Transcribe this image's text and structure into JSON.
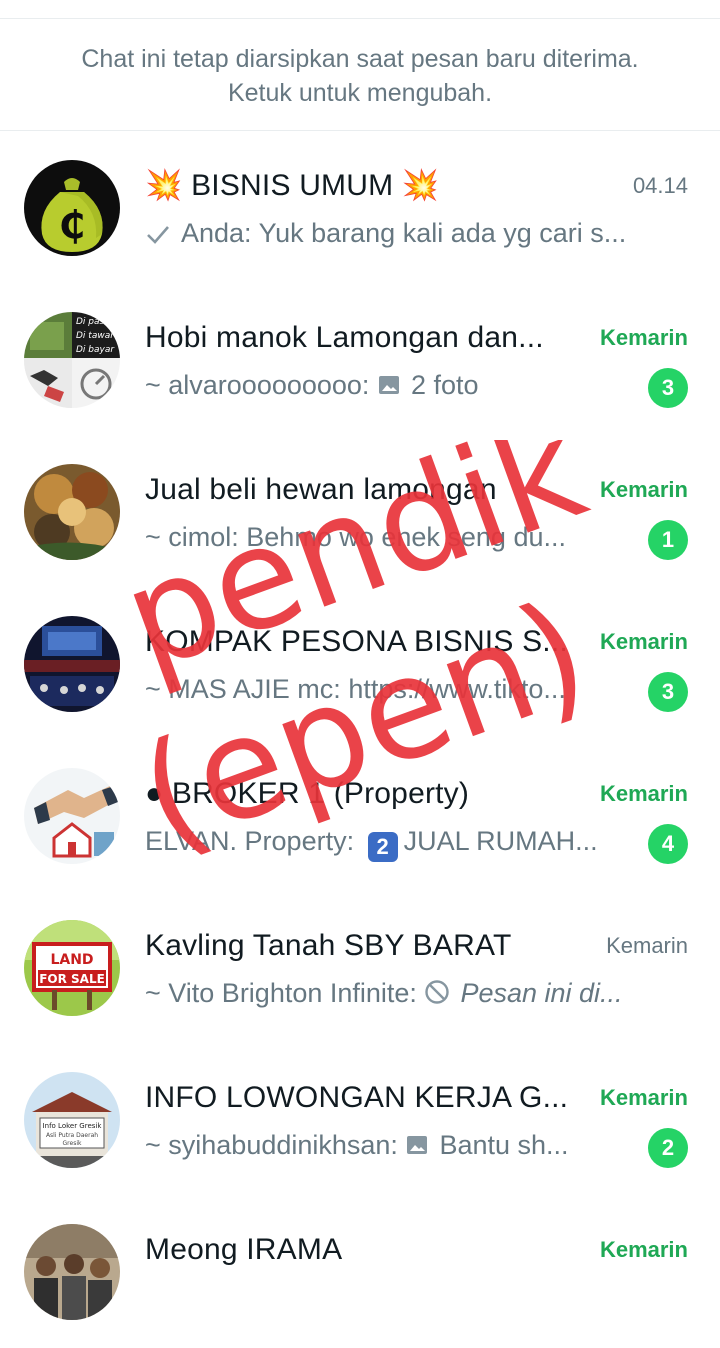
{
  "archive_note": {
    "line1": "Chat ini tetap diarsipkan saat pesan baru diterima.",
    "line2": "Ketuk untuk mengubah."
  },
  "chats": [
    {
      "name": "💥 BISNIS UMUM 💥",
      "time": "04.14",
      "unread": false,
      "sender": "Anda: ",
      "text": "Yuk barang kali ada yg cari s...",
      "icon": "check-icon"
    },
    {
      "name": "Hobi manok Lamongan dan...",
      "time": "Kemarin",
      "unread": true,
      "badge": "3",
      "sender": "~ alvarooooooooo: ",
      "text": "2 foto",
      "icon": "photo-icon"
    },
    {
      "name": "Jual beli hewan lamongan",
      "time": "Kemarin",
      "unread": true,
      "badge": "1",
      "sender": "~ cimol: ",
      "text": "Behmo wo enek seng du..."
    },
    {
      "name": "KOMPAK PESONA BISNIS S...",
      "time": "Kemarin",
      "unread": true,
      "badge": "3",
      "sender": "~ MAS AJIE mc: ",
      "text": "https://www.tikto..."
    },
    {
      "name": "● BROKER 1 (Property)",
      "time": "Kemarin",
      "unread": true,
      "badge": "4",
      "sender": "ELVAN. Property: ",
      "keycap": "2",
      "text": "JUAL RUMAH..."
    },
    {
      "name": "Kavling Tanah SBY BARAT",
      "time": "Kemarin",
      "unread": false,
      "sender": "~ Vito Brighton Infinite: ",
      "text": "Pesan ini di...",
      "icon": "deleted-icon"
    },
    {
      "name": "INFO LOWONGAN KERJA G...",
      "time": "Kemarin",
      "unread": true,
      "badge": "2",
      "sender": "~ syihabuddinikhsan: ",
      "text": "Bantu sh...",
      "icon": "photo-icon"
    },
    {
      "name": "Meong IRAMA",
      "time": "Kemarin",
      "unread": true
    }
  ],
  "avatar_text": {
    "hobi_lines": [
      "Di pasar",
      "Di tawar",
      "Di bayar"
    ],
    "land_line1": "LAND",
    "land_line2": "FOR SALE",
    "info_loker_line1": "Info Loker Gresik",
    "info_loker_line2": "Asli Putra Daerah",
    "info_loker_line3": "Gresik"
  },
  "overlay": {
    "line1": "pendik",
    "line2": "(epen)",
    "color": "#e8333a"
  },
  "colors": {
    "accent_green": "#1fa855",
    "badge_green": "#25d366",
    "secondary_text": "#667781"
  }
}
